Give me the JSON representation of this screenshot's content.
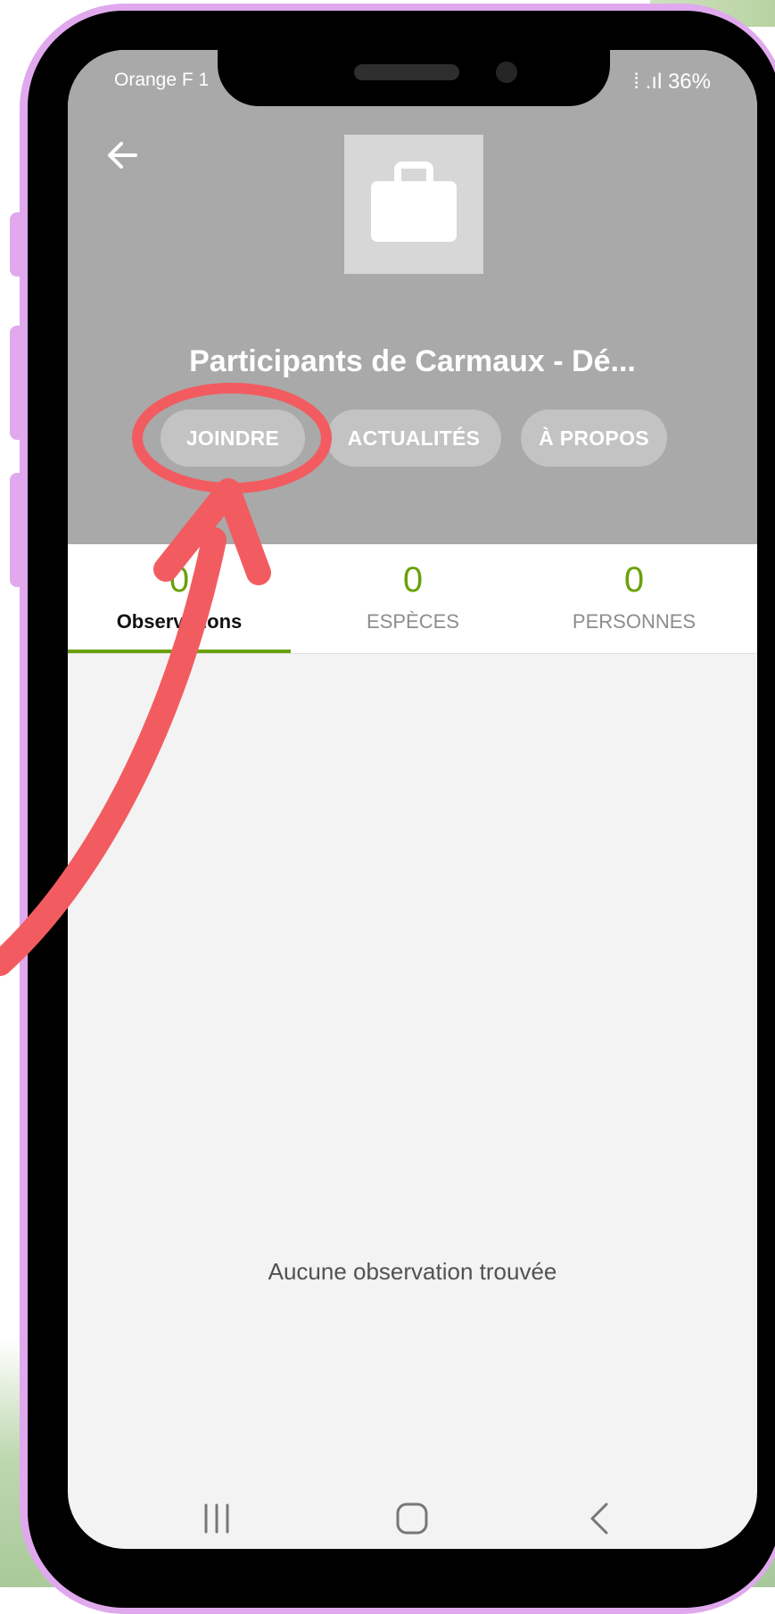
{
  "status_bar": {
    "carrier": "Orange F 1",
    "battery": "⁞ .ıl 36%"
  },
  "header": {
    "title": "Participants de Carmaux - Dé...",
    "buttons": [
      {
        "label": "JOINDRE"
      },
      {
        "label": "ACTUALITÉS"
      },
      {
        "label": "À PROPOS"
      }
    ]
  },
  "tabs": [
    {
      "count": "0",
      "label": "Observations",
      "active": true
    },
    {
      "count": "0",
      "label": "ESPÈCES",
      "active": false
    },
    {
      "count": "0",
      "label": "PERSONNES",
      "active": false
    }
  ],
  "content": {
    "empty_message": "Aucune observation trouvée"
  },
  "icons": {
    "back": "back-arrow-icon",
    "group": "briefcase-icon",
    "nav": [
      "recent-apps-icon",
      "home-icon",
      "back-nav-icon"
    ]
  },
  "colors": {
    "header_bg": "#a9a9a9",
    "accent_green": "#6aa10b",
    "annotation_red": "#f25c60",
    "phone_frame": "#e0a9ee"
  }
}
